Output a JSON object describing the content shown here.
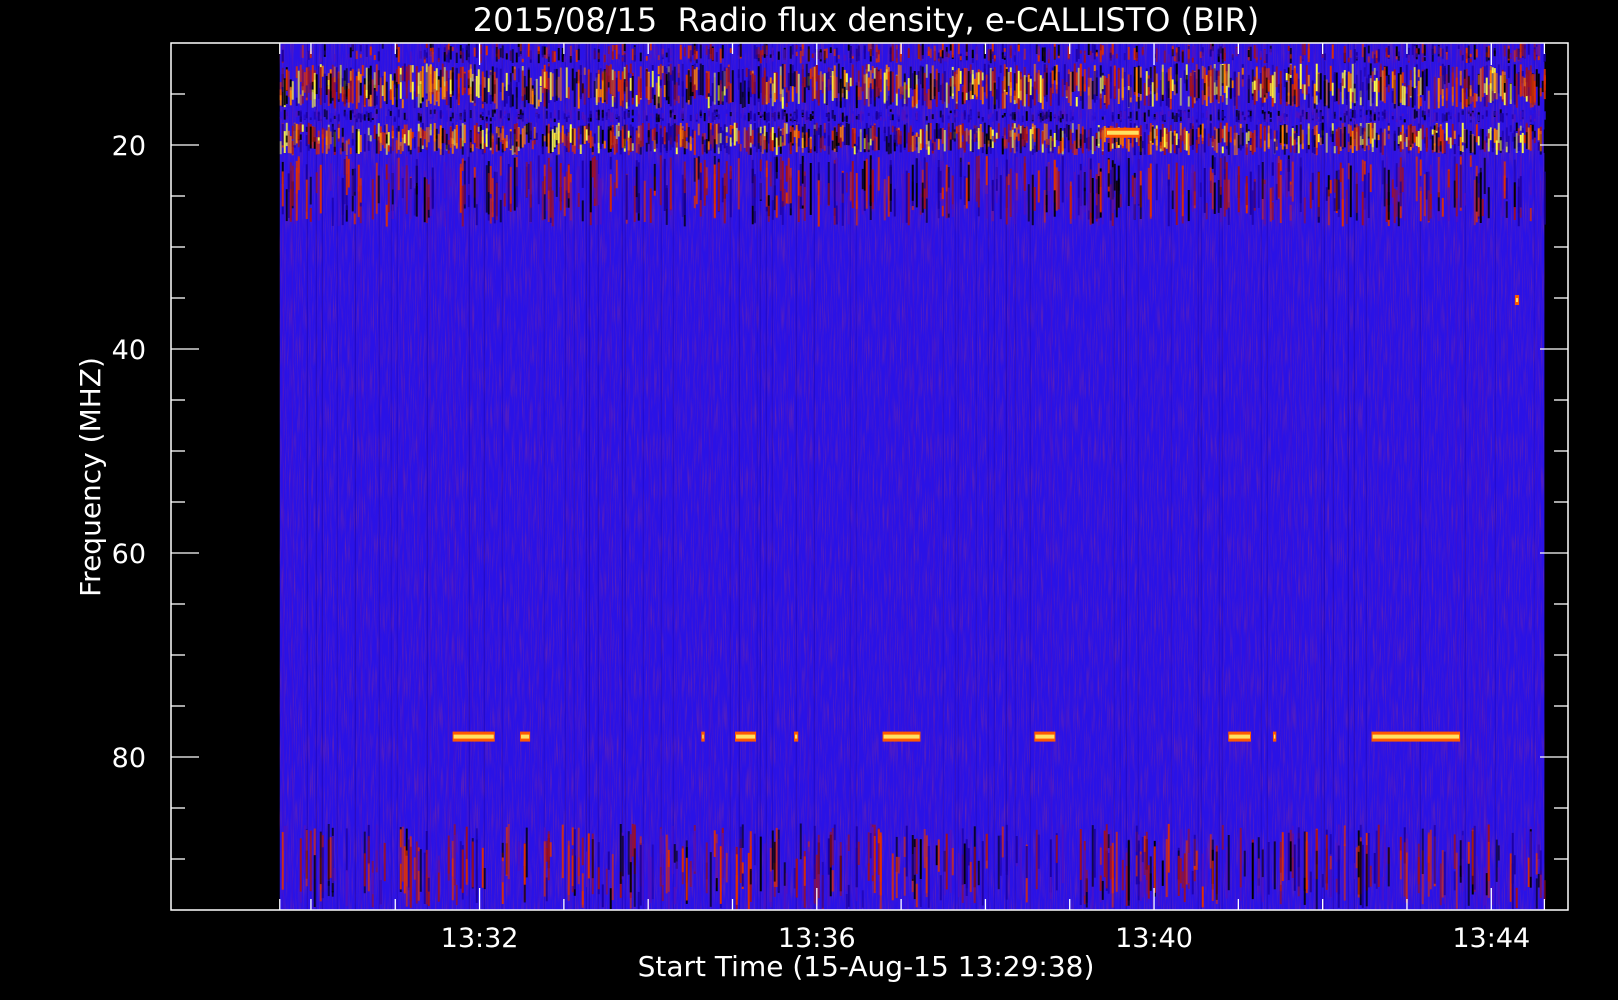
{
  "chart_data": {
    "type": "heatmap",
    "title": "2015/08/15  Radio flux density, e-CALLISTO (BIR)",
    "xlabel": "Start Time (15-Aug-15 13:29:38)",
    "ylabel": "Frequency (MHZ)",
    "x_unit": "minutes after 13:29:38 start",
    "xlim": [
      -1.29,
      15.28
    ],
    "ylim": [
      95,
      10
    ],
    "data_extent": {
      "time": [
        "13:29:38",
        "13:44:38"
      ],
      "frequency_mhz": [
        10,
        95
      ]
    },
    "x_major_ticks": [
      {
        "value": 2.37,
        "label": "13:32"
      },
      {
        "value": 6.37,
        "label": "13:36"
      },
      {
        "value": 10.37,
        "label": "13:40"
      },
      {
        "value": 14.37,
        "label": "13:44"
      }
    ],
    "x_minor_ticks": [
      0.0,
      0.37,
      1.37,
      3.37,
      4.37,
      5.37,
      7.37,
      8.37,
      9.37,
      11.37,
      12.37,
      13.37,
      15.0
    ],
    "y_major_ticks": [
      {
        "value": 20,
        "label": "20"
      },
      {
        "value": 40,
        "label": "40"
      },
      {
        "value": 60,
        "label": "60"
      },
      {
        "value": 80,
        "label": "80"
      }
    ],
    "y_minor_ticks": [
      15,
      25,
      30,
      35,
      45,
      50,
      55,
      65,
      70,
      75,
      85,
      90
    ],
    "colormap": [
      "#000000",
      "#1a00a0",
      "#2a10e0",
      "#5010c0",
      "#a01020",
      "#e03000",
      "#ff8000",
      "#ffff40"
    ],
    "background_level_color": "#2a12e6",
    "interference_bands_mhz": [
      {
        "from": 10.0,
        "to": 12.0,
        "intensity": "moderate"
      },
      {
        "from": 12.0,
        "to": 16.5,
        "intensity": "high"
      },
      {
        "from": 16.5,
        "to": 17.8,
        "intensity": "low"
      },
      {
        "from": 17.8,
        "to": 21.0,
        "intensity": "high"
      },
      {
        "from": 21.0,
        "to": 28.0,
        "intensity": "moderate"
      },
      {
        "from": 86.5,
        "to": 95.0,
        "intensity": "moderate"
      }
    ],
    "bright_blips": [
      {
        "start": 2.05,
        "end": 2.55,
        "freq_mhz": 78.0
      },
      {
        "start": 2.85,
        "end": 2.97,
        "freq_mhz": 78.0
      },
      {
        "start": 5.0,
        "end": 5.04,
        "freq_mhz": 78.0
      },
      {
        "start": 5.4,
        "end": 5.65,
        "freq_mhz": 78.0
      },
      {
        "start": 6.1,
        "end": 6.15,
        "freq_mhz": 78.0
      },
      {
        "start": 7.15,
        "end": 7.6,
        "freq_mhz": 78.0
      },
      {
        "start": 8.95,
        "end": 9.2,
        "freq_mhz": 78.0
      },
      {
        "start": 11.25,
        "end": 11.52,
        "freq_mhz": 78.0
      },
      {
        "start": 11.78,
        "end": 11.82,
        "freq_mhz": 78.0
      },
      {
        "start": 12.95,
        "end": 14.0,
        "freq_mhz": 78.0
      },
      {
        "start": 9.8,
        "end": 10.2,
        "freq_mhz": 18.8
      },
      {
        "start": 14.65,
        "end": 14.7,
        "freq_mhz": 35.2
      }
    ]
  }
}
